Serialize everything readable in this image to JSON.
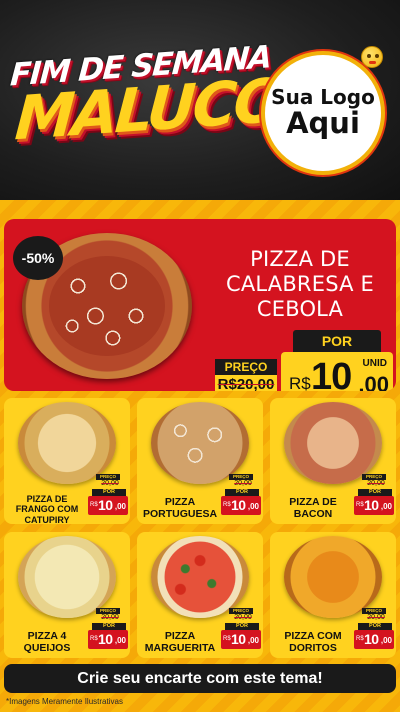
{
  "header": {
    "title_top": "FIM DE SEMANA",
    "title_bottom": "MALUCO",
    "logo_line1": "Sua Logo",
    "logo_line2": "Aqui"
  },
  "featured": {
    "discount": "-50%",
    "name": "PIZZA DE CALABRESA E CEBOLA",
    "preco_label": "PREÇO",
    "old_price": "R$20,00",
    "por_label": "POR",
    "currency": "R$",
    "price_int": "10",
    "price_dec": ",00",
    "unit": "UNID"
  },
  "products": [
    {
      "name": "PIZZA DE FRANGO COM CATUPIRY",
      "preco_label": "PREÇO",
      "old_price": "20,00",
      "por_label": "POR",
      "currency": "R$",
      "price_int": "10",
      "price_dec": ",00"
    },
    {
      "name": "PIZZA PORTUGUESA",
      "preco_label": "PREÇO",
      "old_price": "20,00",
      "por_label": "POR",
      "currency": "R$",
      "price_int": "10",
      "price_dec": ",00"
    },
    {
      "name": "PIZZA DE BACON",
      "preco_label": "PREÇO",
      "old_price": "20,00",
      "por_label": "POR",
      "currency": "R$",
      "price_int": "10",
      "price_dec": ",00"
    },
    {
      "name": "PIZZA 4 QUEIJOS",
      "preco_label": "PREÇO",
      "old_price": "20,00",
      "por_label": "POR",
      "currency": "R$",
      "price_int": "10",
      "price_dec": ",00"
    },
    {
      "name": "PIZZA MARGUERITA",
      "preco_label": "PREÇO",
      "old_price": "20,00",
      "por_label": "POR",
      "currency": "R$",
      "price_int": "10",
      "price_dec": ",00"
    },
    {
      "name": "PIZZA COM DORITOS",
      "preco_label": "PREÇO",
      "old_price": "20,00",
      "por_label": "POR",
      "currency": "R$",
      "price_int": "10",
      "price_dec": ",00"
    }
  ],
  "cta": "Crie seu encarte com este tema!",
  "disclaimer": "*Imagens Meramente Ilustrativas",
  "colors": {
    "red": "#d4131f",
    "yellow": "#ffd21f",
    "orange": "#f8b70a",
    "dark": "#1a1a1a"
  }
}
